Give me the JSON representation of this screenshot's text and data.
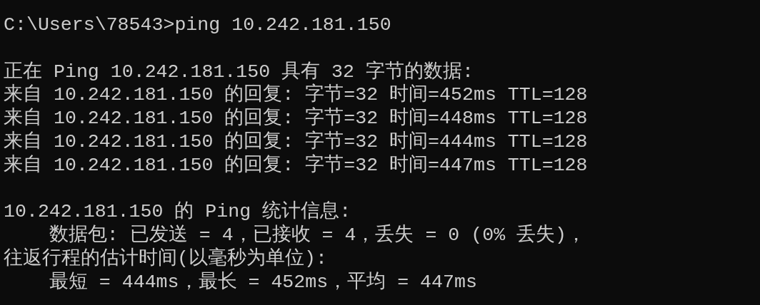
{
  "console": {
    "blocks": [
      [
        "C:\\Users\\78543>ping 10.242.181.150"
      ],
      [
        "正在 Ping 10.242.181.150 具有 32 字节的数据:",
        "来自 10.242.181.150 的回复: 字节=32 时间=452ms TTL=128",
        "来自 10.242.181.150 的回复: 字节=32 时间=448ms TTL=128",
        "来自 10.242.181.150 的回复: 字节=32 时间=444ms TTL=128",
        "来自 10.242.181.150 的回复: 字节=32 时间=447ms TTL=128"
      ],
      [
        "10.242.181.150 的 Ping 统计信息:",
        "    数据包: 已发送 = 4，已接收 = 4，丢失 = 0 (0% 丢失)，",
        "往返行程的估计时间(以毫秒为单位):",
        "    最短 = 444ms，最长 = 452ms，平均 = 447ms"
      ]
    ]
  }
}
